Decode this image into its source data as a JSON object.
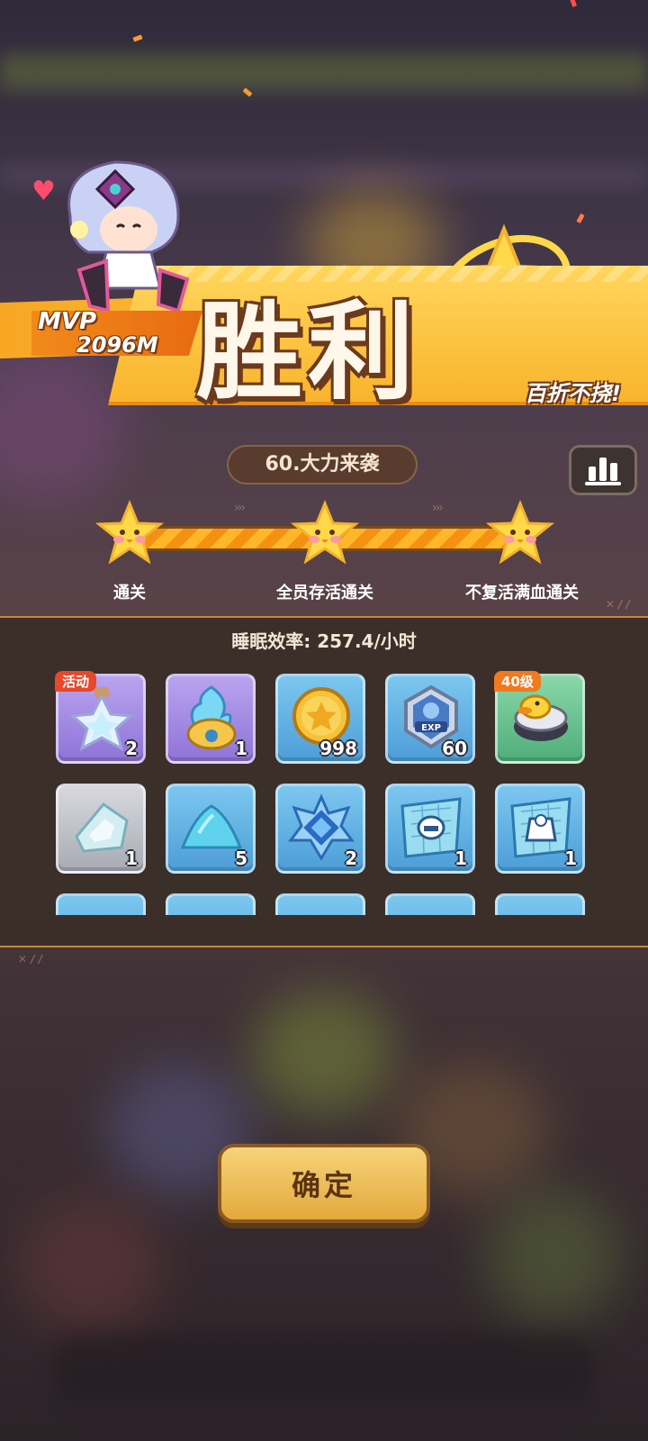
{
  "banner": {
    "title": "胜利",
    "subtitle": "百折不挠!",
    "mvp_label": "MVP",
    "mvp_value": "2096M"
  },
  "stage": {
    "name": "60.大力来袭"
  },
  "goals": [
    {
      "label": "通关"
    },
    {
      "label": "全员存活通关"
    },
    {
      "label": "不复活满血通关"
    }
  ],
  "rewards": {
    "sleep_rate": "睡眠效率: 257.4/小时",
    "items": [
      {
        "name": "star-bottle",
        "count": "2",
        "tag": "活动",
        "color": "purple"
      },
      {
        "name": "blue-flame-capsule",
        "count": "1",
        "tag": "",
        "color": "purple"
      },
      {
        "name": "gold-coin",
        "count": "998",
        "tag": "",
        "color": "blue"
      },
      {
        "name": "exp-badge",
        "count": "60",
        "tag": "",
        "color": "blue"
      },
      {
        "name": "duck-hat",
        "count": "",
        "tag": "40级",
        "color": "green"
      },
      {
        "name": "crystal-shard",
        "count": "1",
        "tag": "",
        "color": "gray"
      },
      {
        "name": "blue-powder",
        "count": "5",
        "tag": "",
        "color": "blue"
      },
      {
        "name": "blue-gem-star",
        "count": "2",
        "tag": "",
        "color": "blue"
      },
      {
        "name": "helmet-blueprint",
        "count": "1",
        "tag": "",
        "color": "blue"
      },
      {
        "name": "armor-blueprint",
        "count": "1",
        "tag": "",
        "color": "blue"
      }
    ]
  },
  "confirm": {
    "label": "确定"
  },
  "colors": {
    "banner_yellow": "#f9b42c",
    "title_outline": "#6b3a1e",
    "panel_border": "#c4883a",
    "tag_red": "#e8472a",
    "button_gold": "#e3a93c"
  }
}
